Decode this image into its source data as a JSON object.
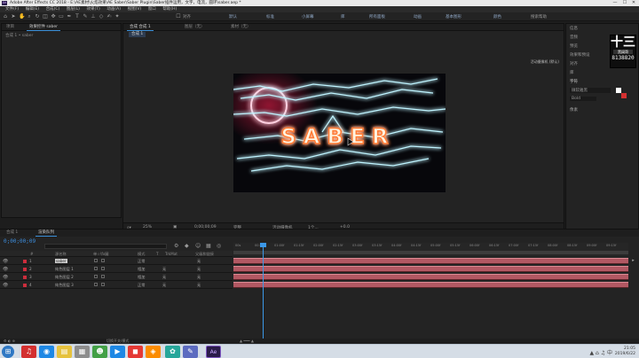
{
  "window": {
    "title": "Adobe After Effects CC 2018 - E:\\AE素材\\火焰效果\\AE Saber\\Saber Plugin\\Saber插件运用，文字，电流，圆环\\saber.aep *",
    "minimize": "—",
    "maximize": "☐",
    "close": "✕",
    "app_icon": "Ae"
  },
  "menu": [
    "文件(F)",
    "编辑(E)",
    "合成(C)",
    "图层(L)",
    "效果(T)",
    "动画(A)",
    "视图(V)",
    "窗口",
    "帮助(H)"
  ],
  "toolbar": {
    "snap_label": "对齐",
    "workspaces": [
      "默认",
      "标准",
      "小屏幕",
      "库",
      "所有面板",
      "动画",
      "基本图形",
      "颜色"
    ],
    "search_help": "搜索帮助"
  },
  "project_panel": {
    "tabs": [
      "项目",
      "效果控件 saber"
    ],
    "subtitle": "合成 1 • saber"
  },
  "comp_panel": {
    "tabs": [
      "合成 合成 1",
      "图层（无）",
      "素材（无）"
    ],
    "comp_tab": "合成 1",
    "active_camera": "活动摄像机 (默认)",
    "footer": {
      "zoom": "25%",
      "timecode": "0;00;00;09",
      "resolution": "完整",
      "camera": "活动摄像机",
      "views": "1个...",
      "offset": "+0.0"
    },
    "render_text": "SABER"
  },
  "right_panel": {
    "rows": [
      "信息",
      "音频",
      "预览",
      "效果和预设",
      "对齐",
      "库",
      "字符"
    ],
    "font": "微软雅黑",
    "font_style": "Bold",
    "size_label": "像素",
    "watermark": {
      "name": "黑阔哥",
      "number": "8138820"
    }
  },
  "timeline": {
    "tabs": [
      "合成 1",
      "渲染队列"
    ],
    "timecode": "0;00;00;09",
    "search_placeholder": "",
    "columns": [
      "#",
      "源名称",
      "单☆\\fx圖",
      "模式",
      "T",
      "TrkMat",
      "父级和链接"
    ],
    "layers": [
      {
        "num": "1",
        "name": "saber",
        "mode": "正常",
        "trkmat": "",
        "parent": "无",
        "selected": true
      },
      {
        "num": "2",
        "name": "纯色图层 1",
        "mode": "相加",
        "trkmat": "无",
        "parent": "无",
        "selected": false
      },
      {
        "num": "3",
        "name": "纯色图层 2",
        "mode": "相加",
        "trkmat": "无",
        "parent": "无",
        "selected": false
      },
      {
        "num": "4",
        "name": "纯色图层 3",
        "mode": "正常",
        "trkmat": "无",
        "parent": "无",
        "selected": false
      }
    ],
    "ruler_ticks": [
      "00s",
      "00:15f",
      "01:00f",
      "01:15f",
      "02:00f",
      "02:15f",
      "03:00f",
      "03:15f",
      "04:00f",
      "04:15f",
      "05:00f",
      "05:15f",
      "06:00f",
      "06:15f",
      "07:00f",
      "07:15f",
      "08:00f",
      "08:15f",
      "09:00f",
      "09:15f"
    ],
    "footer_left": "切换开关/模式"
  },
  "taskbar": {
    "time": "21:05",
    "date": "2019/6/22",
    "tray": "▲ ⌂ ♫ 中"
  },
  "colors": {
    "accent": "#3b98e8",
    "layer_bar": "#b25863",
    "layer_label": "#cc2d3c"
  }
}
